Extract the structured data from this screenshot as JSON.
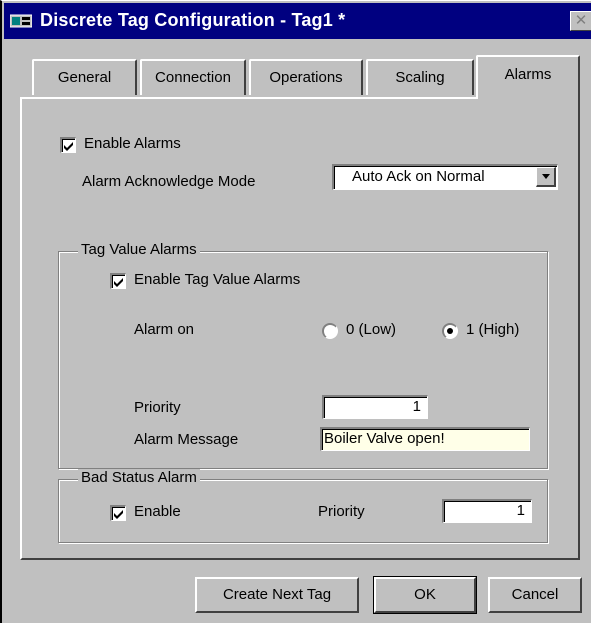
{
  "window": {
    "title": "Discrete Tag Configuration - Tag1 *",
    "close_glyph": "✕",
    "title_icon": "tag-config-icon",
    "title_bar_color": "#000080"
  },
  "tabs": [
    {
      "label": "General",
      "active": false
    },
    {
      "label": "Connection",
      "active": false
    },
    {
      "label": "Operations",
      "active": false
    },
    {
      "label": "Scaling",
      "active": false
    },
    {
      "label": "Alarms",
      "active": true
    }
  ],
  "alarms": {
    "enable_alarms": {
      "label": "Enable Alarms",
      "checked": true
    },
    "ack_mode": {
      "label": "Alarm Acknowledge Mode",
      "value": "Auto Ack on Normal"
    },
    "tag_value_alarms": {
      "group_title": "Tag Value Alarms",
      "enable": {
        "label": "Enable Tag Value Alarms",
        "checked": true
      },
      "alarm_on_label": "Alarm on",
      "options": [
        {
          "label": "0 (Low)",
          "selected": false
        },
        {
          "label": "1 (High)",
          "selected": true
        }
      ],
      "priority_label": "Priority",
      "priority_value": "1",
      "message_label": "Alarm Message",
      "message_value": "Boiler Valve open!"
    },
    "bad_status_alarm": {
      "group_title": "Bad Status Alarm",
      "enable": {
        "label": "Enable",
        "checked": true
      },
      "priority_label": "Priority",
      "priority_value": "1"
    }
  },
  "buttons": {
    "create_next_tag": "Create Next Tag",
    "ok": "OK",
    "cancel": "Cancel"
  }
}
